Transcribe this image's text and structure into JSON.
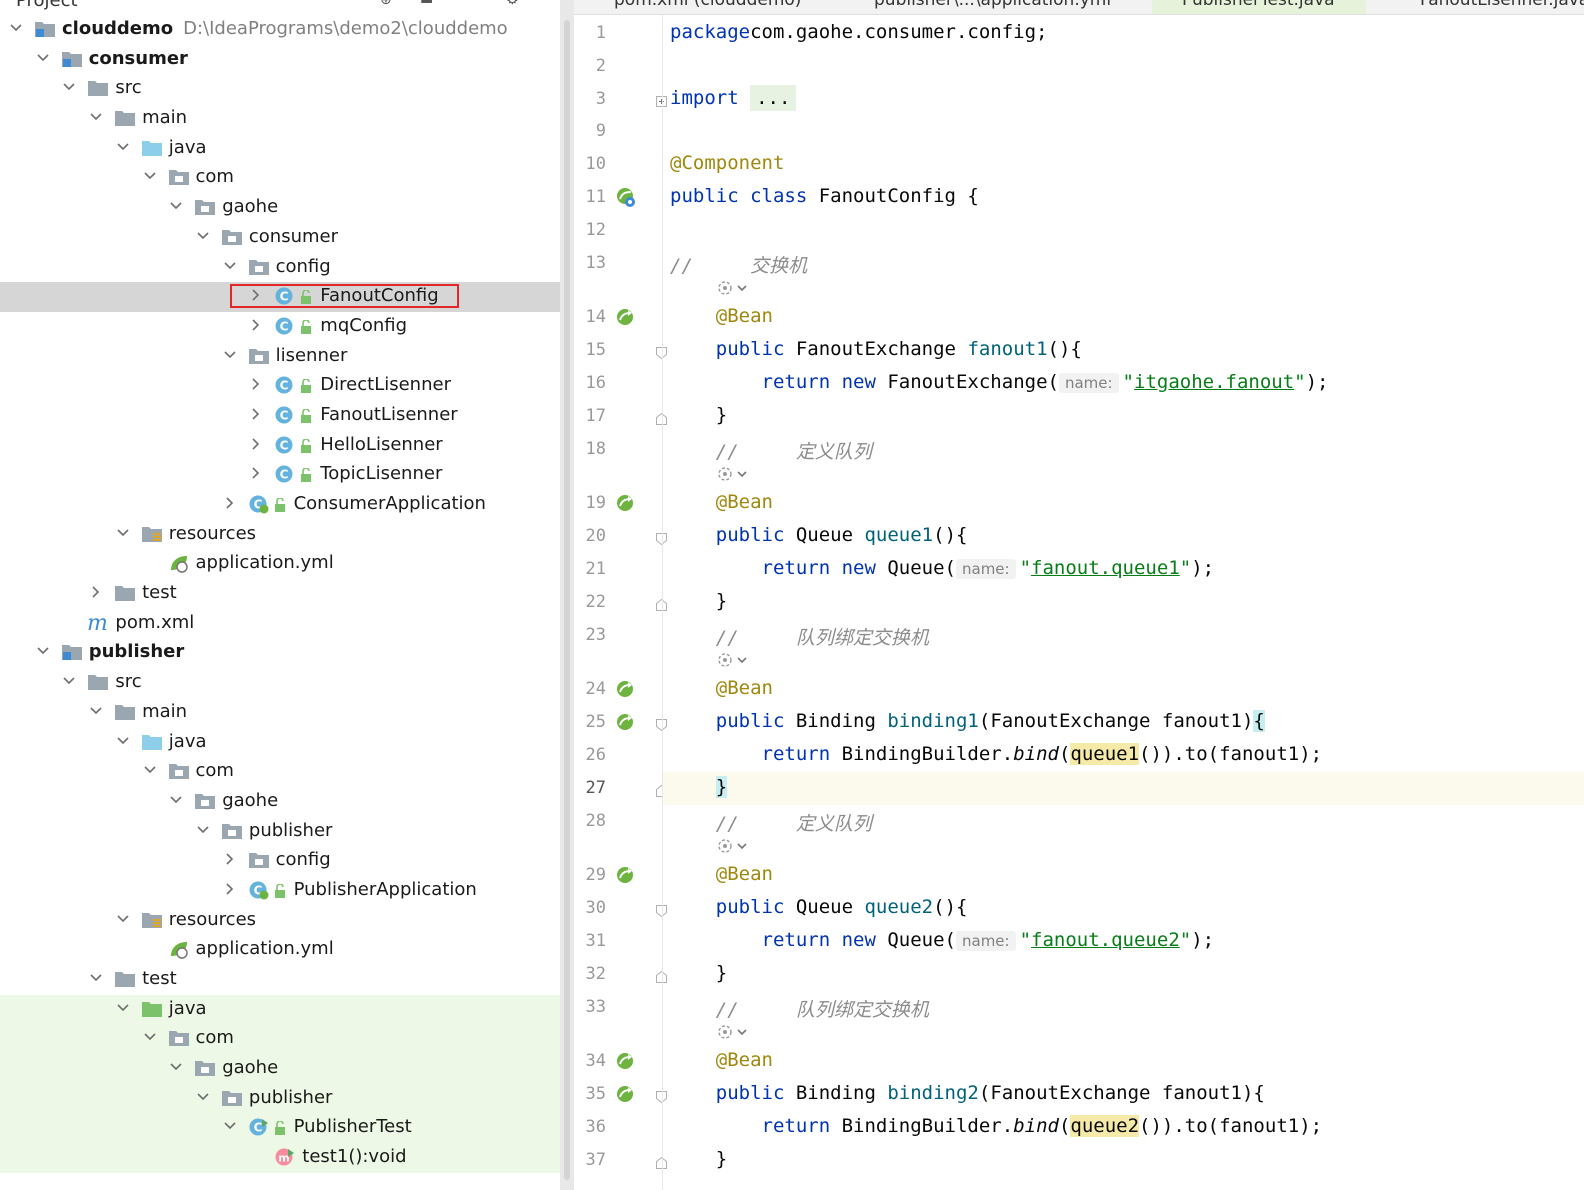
{
  "project_panel": {
    "title": "Project",
    "tree": [
      {
        "label": "clouddemo",
        "path": "D:\\IdeaPrograms\\demo2\\clouddemo",
        "bold": true,
        "icon": "module-folder-icon",
        "arrow": "down",
        "depth": 0
      },
      {
        "label": "consumer",
        "bold": true,
        "icon": "module-folder-icon",
        "arrow": "down",
        "depth": 1
      },
      {
        "label": "src",
        "icon": "folder-icon",
        "arrow": "down",
        "depth": 2
      },
      {
        "label": "main",
        "icon": "folder-icon",
        "arrow": "down",
        "depth": 3
      },
      {
        "label": "java",
        "icon": "source-folder-icon",
        "arrow": "down",
        "depth": 4
      },
      {
        "label": "com",
        "icon": "package-icon",
        "arrow": "down",
        "depth": 5
      },
      {
        "label": "gaohe",
        "icon": "package-icon",
        "arrow": "down",
        "depth": 6
      },
      {
        "label": "consumer",
        "icon": "package-icon",
        "arrow": "down",
        "depth": 7
      },
      {
        "label": "config",
        "icon": "package-icon",
        "arrow": "down",
        "depth": 8
      },
      {
        "label": "FanoutConfig",
        "icon": "class-icon",
        "arrow": "right",
        "depth": 9,
        "selected": true,
        "lock": true
      },
      {
        "label": "mqConfig",
        "icon": "class-icon",
        "arrow": "right",
        "depth": 9,
        "lock": true
      },
      {
        "label": "lisenner",
        "icon": "package-icon",
        "arrow": "down",
        "depth": 8
      },
      {
        "label": "DirectLisenner",
        "icon": "class-icon",
        "arrow": "right",
        "depth": 9,
        "lock": true
      },
      {
        "label": "FanoutLisenner",
        "icon": "class-icon",
        "arrow": "right",
        "depth": 9,
        "lock": true
      },
      {
        "label": "HelloLisenner",
        "icon": "class-icon",
        "arrow": "right",
        "depth": 9,
        "lock": true
      },
      {
        "label": "TopicLisenner",
        "icon": "class-icon",
        "arrow": "right",
        "depth": 9,
        "lock": true
      },
      {
        "label": "ConsumerApplication",
        "icon": "spring-boot-class-icon",
        "arrow": "right",
        "depth": 8,
        "lock": true
      },
      {
        "label": "resources",
        "icon": "resources-folder-icon",
        "arrow": "down",
        "depth": 4
      },
      {
        "label": "application.yml",
        "icon": "spring-yml-icon",
        "arrow": "none",
        "depth": 5
      },
      {
        "label": "test",
        "icon": "folder-icon",
        "arrow": "right",
        "depth": 3
      },
      {
        "label": "pom.xml",
        "icon": "maven-icon",
        "arrow": "none",
        "depth": 2
      },
      {
        "label": "publisher",
        "bold": true,
        "icon": "module-folder-icon",
        "arrow": "down",
        "depth": 1
      },
      {
        "label": "src",
        "icon": "folder-icon",
        "arrow": "down",
        "depth": 2
      },
      {
        "label": "main",
        "icon": "folder-icon",
        "arrow": "down",
        "depth": 3
      },
      {
        "label": "java",
        "icon": "source-folder-icon",
        "arrow": "down",
        "depth": 4
      },
      {
        "label": "com",
        "icon": "package-icon",
        "arrow": "down",
        "depth": 5
      },
      {
        "label": "gaohe",
        "icon": "package-icon",
        "arrow": "down",
        "depth": 6
      },
      {
        "label": "publisher",
        "icon": "package-icon",
        "arrow": "down",
        "depth": 7
      },
      {
        "label": "config",
        "icon": "package-icon",
        "arrow": "right",
        "depth": 8
      },
      {
        "label": "PublisherApplication",
        "icon": "spring-boot-class-icon",
        "arrow": "right",
        "depth": 8,
        "lock": true
      },
      {
        "label": "resources",
        "icon": "resources-folder-icon",
        "arrow": "down",
        "depth": 4
      },
      {
        "label": "application.yml",
        "icon": "spring-yml-icon",
        "arrow": "none",
        "depth": 5
      },
      {
        "label": "test",
        "icon": "folder-icon",
        "arrow": "down",
        "depth": 3
      },
      {
        "label": "java",
        "icon": "test-folder-icon",
        "arrow": "down",
        "depth": 4,
        "green": true
      },
      {
        "label": "com",
        "icon": "package-icon",
        "arrow": "down",
        "depth": 5,
        "green": true
      },
      {
        "label": "gaohe",
        "icon": "package-icon",
        "arrow": "down",
        "depth": 6,
        "green": true
      },
      {
        "label": "publisher",
        "icon": "package-icon",
        "arrow": "down",
        "depth": 7,
        "green": true
      },
      {
        "label": "PublisherTest",
        "icon": "test-class-icon",
        "arrow": "down",
        "depth": 8,
        "lock": true,
        "green": true
      },
      {
        "label": "test1():void",
        "icon": "method-icon",
        "arrow": "none",
        "depth": 9,
        "green": true
      }
    ]
  },
  "editor": {
    "tabs": [
      {
        "label": "pom.xml (clouddemo)"
      },
      {
        "label": "publisher\\...\\application.yml"
      },
      {
        "label": "PublisherTest.java",
        "active": true
      },
      {
        "label": "FanoutLisenner.java"
      }
    ],
    "lines": [
      {
        "n": "1",
        "parts": [
          [
            "kw",
            "package"
          ],
          [
            "",
            "com.gaohe.consumer.config;"
          ]
        ]
      },
      {
        "n": "2",
        "parts": []
      },
      {
        "n": "3",
        "fold": "plus",
        "parts": [
          [
            "kw",
            "import"
          ],
          [
            "",
            " "
          ],
          [
            "dots",
            "..."
          ]
        ]
      },
      {
        "n": "9",
        "parts": []
      },
      {
        "n": "10",
        "parts": [
          [
            "ann",
            "@Component"
          ]
        ]
      },
      {
        "n": "11",
        "gicon": "bean-class",
        "parts": [
          [
            "kw",
            "public class "
          ],
          [
            "",
            "FanoutConfig {"
          ]
        ]
      },
      {
        "n": "12",
        "parts": []
      },
      {
        "n": "13",
        "parts": [
          [
            "cmt",
            "//     交换机"
          ]
        ]
      },
      {
        "n": "",
        "usage": true,
        "parts": []
      },
      {
        "n": "14",
        "gicon": "bean",
        "parts": [
          [
            "",
            "    "
          ],
          [
            "ann",
            "@Bean"
          ]
        ]
      },
      {
        "n": "15",
        "fold": "open",
        "parts": [
          [
            "",
            "    "
          ],
          [
            "kw",
            "public "
          ],
          [
            "",
            "FanoutExchange "
          ],
          [
            "fn",
            "fanout1"
          ],
          [
            "",
            "(){"
          ]
        ]
      },
      {
        "n": "16",
        "parts": [
          [
            "",
            "        "
          ],
          [
            "kw",
            "return new "
          ],
          [
            "",
            "FanoutExchange("
          ],
          [
            "hint",
            "name:"
          ],
          [
            "str",
            "\""
          ],
          [
            "strul",
            "itgaohe.fanout"
          ],
          [
            "str",
            "\""
          ],
          [
            "",
            ");"
          ]
        ]
      },
      {
        "n": "17",
        "fold": "close",
        "parts": [
          [
            "",
            "    }"
          ]
        ]
      },
      {
        "n": "18",
        "parts": [
          [
            "",
            "    "
          ],
          [
            "cmt",
            "//     定义队列"
          ]
        ]
      },
      {
        "n": "",
        "usage": true,
        "parts": []
      },
      {
        "n": "19",
        "gicon": "bean",
        "parts": [
          [
            "",
            "    "
          ],
          [
            "ann",
            "@Bean"
          ]
        ]
      },
      {
        "n": "20",
        "fold": "open",
        "parts": [
          [
            "",
            "    "
          ],
          [
            "kw",
            "public "
          ],
          [
            "",
            "Queue "
          ],
          [
            "fn",
            "queue1"
          ],
          [
            "",
            "(){"
          ]
        ]
      },
      {
        "n": "21",
        "parts": [
          [
            "",
            "        "
          ],
          [
            "kw",
            "return new "
          ],
          [
            "",
            "Queue("
          ],
          [
            "hint",
            "name:"
          ],
          [
            "str",
            "\""
          ],
          [
            "strul",
            "fanout.queue1"
          ],
          [
            "str",
            "\""
          ],
          [
            "",
            ");"
          ]
        ]
      },
      {
        "n": "22",
        "fold": "close",
        "parts": [
          [
            "",
            "    }"
          ]
        ]
      },
      {
        "n": "23",
        "parts": [
          [
            "",
            "    "
          ],
          [
            "cmt",
            "//     队列绑定交换机"
          ]
        ]
      },
      {
        "n": "",
        "usage": true,
        "parts": []
      },
      {
        "n": "24",
        "gicon": "bean",
        "parts": [
          [
            "",
            "    "
          ],
          [
            "ann",
            "@Bean"
          ]
        ]
      },
      {
        "n": "25",
        "gicon": "bean",
        "fold": "open",
        "parts": [
          [
            "",
            "    "
          ],
          [
            "kw",
            "public "
          ],
          [
            "",
            "Binding "
          ],
          [
            "fn",
            "binding1"
          ],
          [
            "",
            "(FanoutExchange fanout1)"
          ],
          [
            "caret",
            "{"
          ]
        ]
      },
      {
        "n": "26",
        "parts": [
          [
            "",
            "        "
          ],
          [
            "kw",
            "return "
          ],
          [
            "",
            "BindingBuilder."
          ],
          [
            "it",
            "bind"
          ],
          [
            "",
            "("
          ],
          [
            "hl",
            "queue1"
          ],
          [
            "",
            "()).to(fanout1);"
          ]
        ]
      },
      {
        "n": "27",
        "fold": "close",
        "current": true,
        "parts": [
          [
            "",
            "    "
          ],
          [
            "caret",
            "}"
          ]
        ]
      },
      {
        "n": "28",
        "parts": [
          [
            "",
            "    "
          ],
          [
            "cmt",
            "//     定义队列"
          ]
        ]
      },
      {
        "n": "",
        "usage": true,
        "parts": []
      },
      {
        "n": "29",
        "gicon": "bean",
        "parts": [
          [
            "",
            "    "
          ],
          [
            "ann",
            "@Bean"
          ]
        ]
      },
      {
        "n": "30",
        "fold": "open",
        "parts": [
          [
            "",
            "    "
          ],
          [
            "kw",
            "public "
          ],
          [
            "",
            "Queue "
          ],
          [
            "fn",
            "queue2"
          ],
          [
            "",
            "(){"
          ]
        ]
      },
      {
        "n": "31",
        "parts": [
          [
            "",
            "        "
          ],
          [
            "kw",
            "return new "
          ],
          [
            "",
            "Queue("
          ],
          [
            "hint",
            "name:"
          ],
          [
            "str",
            "\""
          ],
          [
            "strul",
            "fanout.queue2"
          ],
          [
            "str",
            "\""
          ],
          [
            "",
            ");"
          ]
        ]
      },
      {
        "n": "32",
        "fold": "close",
        "parts": [
          [
            "",
            "    }"
          ]
        ]
      },
      {
        "n": "33",
        "parts": [
          [
            "",
            "    "
          ],
          [
            "cmt",
            "//     队列绑定交换机"
          ]
        ]
      },
      {
        "n": "",
        "usage": true,
        "parts": []
      },
      {
        "n": "34",
        "gicon": "bean",
        "parts": [
          [
            "",
            "    "
          ],
          [
            "ann",
            "@Bean"
          ]
        ]
      },
      {
        "n": "35",
        "gicon": "bean",
        "fold": "open",
        "parts": [
          [
            "",
            "    "
          ],
          [
            "kw",
            "public "
          ],
          [
            "",
            "Binding "
          ],
          [
            "fn",
            "binding2"
          ],
          [
            "",
            "(FanoutExchange fanout1){"
          ]
        ]
      },
      {
        "n": "36",
        "parts": [
          [
            "",
            "        "
          ],
          [
            "kw",
            "return "
          ],
          [
            "",
            "BindingBuilder."
          ],
          [
            "it",
            "bind"
          ],
          [
            "",
            "("
          ],
          [
            "hl",
            "queue2"
          ],
          [
            "",
            "()).to(fanout1);"
          ]
        ]
      },
      {
        "n": "37",
        "fold": "close",
        "parts": [
          [
            "",
            "    }"
          ]
        ]
      }
    ]
  },
  "colors": {
    "selection": "#d6d6d6",
    "highlight_box": "#e3262a",
    "test_background": "#eef8e6",
    "keyword": "#0033b3",
    "annotation": "#9e880d",
    "string": "#067d17"
  }
}
